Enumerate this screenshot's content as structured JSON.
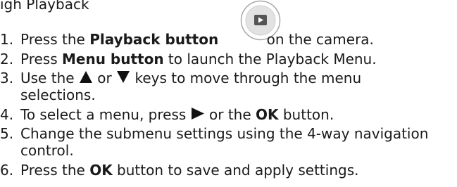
{
  "partial_header": "igh Playback",
  "steps": [
    {
      "num": "1.",
      "pre": "Press the ",
      "bold": "Playback button",
      "post": " on the camera.",
      "icon": "playback-button-icon"
    },
    {
      "num": "2.",
      "pre": "Press ",
      "bold": "Menu button",
      "post": " to launch the Playback Menu."
    },
    {
      "num": "3.",
      "pre": "Use the ",
      "mid1": " or ",
      "mid2": " keys to move through the menu",
      "cont": "selections.",
      "icons": [
        "up-arrow-icon",
        "down-arrow-icon"
      ]
    },
    {
      "num": "4.",
      "pre": "To select a menu, press ",
      "mid": " or the ",
      "bold": "OK",
      "post": " button.",
      "icon": "right-arrow-icon"
    },
    {
      "num": "5.",
      "pre": "Change the submenu settings using the 4-way navigation",
      "cont": "control."
    },
    {
      "num": "6.",
      "pre": "Press the ",
      "bold": "OK",
      "post": " button to save and apply settings."
    }
  ]
}
